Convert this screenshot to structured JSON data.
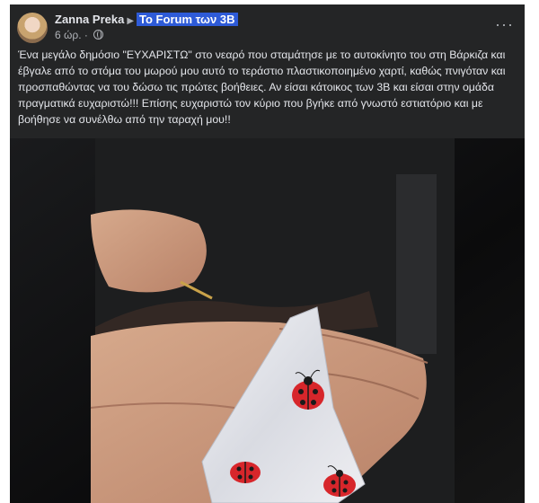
{
  "post": {
    "author": "Zanna Preka",
    "group": "Το Forum των 3Β",
    "time": "6 ώρ.",
    "more_label": "···",
    "text": "Ένα μεγάλο δημόσιο \"ΕΥΧΑΡΙΣΤΩ\" στο νεαρό που σταμάτησε με το αυτοκίνητο του στη Βάρκιζα και έβγαλε από το στόμα του μωρού μου αυτό το τεράστιο πλαστικοποιημένο χαρτί, καθώς πνιγόταν και προσπαθώντας να του δώσω τις πρώτες βοήθειες. Αν είσαι κάτοικος των 3Β και είσαι στην ομάδα πραγματικά ευχαριστώ!!! Επίσης ευχαριστώ τον κύριο που βγήκε από γνωστό εστιατόριο και με βοήθησε να συνέλθω από την ταραχή μου!!"
  },
  "colors": {
    "card_bg": "#242526",
    "text": "#e4e6eb",
    "muted": "#b0b3b8",
    "group_highlight": "#2e5bd8"
  }
}
